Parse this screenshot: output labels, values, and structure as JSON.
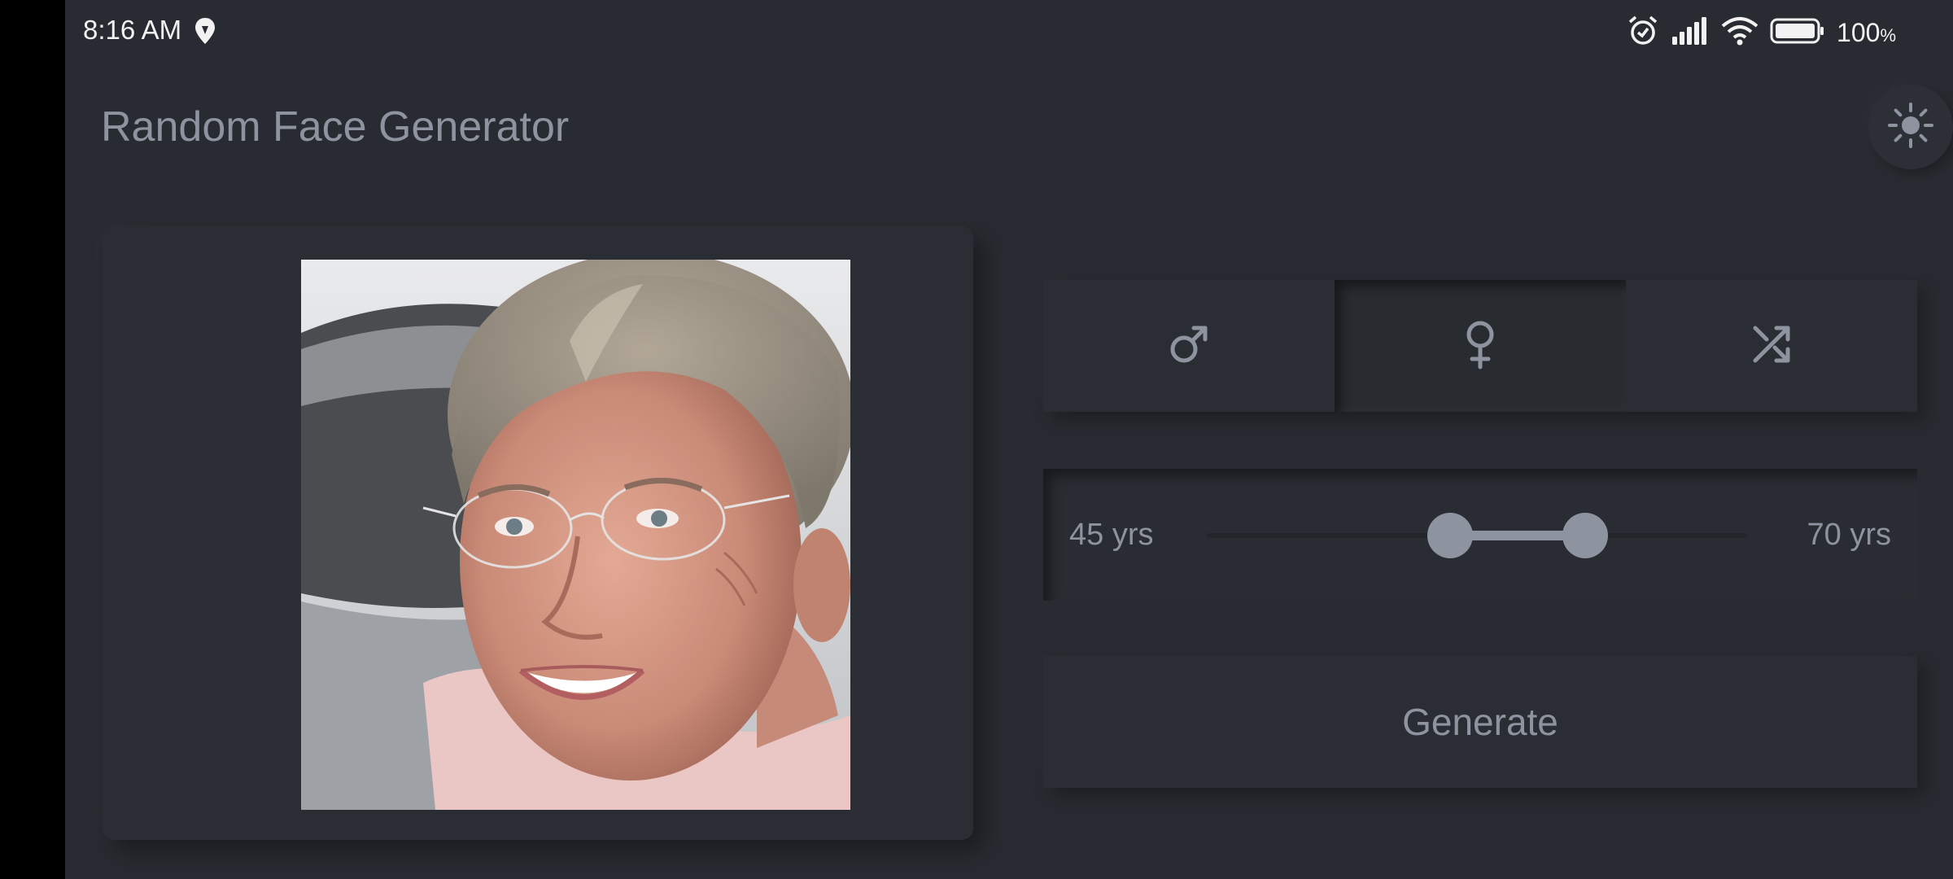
{
  "status_bar": {
    "time": "8:16 AM",
    "battery_percent": "100",
    "battery_unit": "%",
    "icons": [
      "location-icon",
      "alarm-icon",
      "signal-icon",
      "wifi-icon",
      "battery-icon"
    ]
  },
  "app_bar": {
    "title": "Random Face Generator",
    "theme_icon": "sun-icon"
  },
  "gender_selector": {
    "options": [
      {
        "icon": "male-icon",
        "selected": false
      },
      {
        "icon": "female-icon",
        "selected": true
      },
      {
        "icon": "shuffle-icon",
        "selected": false
      }
    ]
  },
  "age_range": {
    "min_label": "45 yrs",
    "max_label": "70 yrs",
    "low_fraction": 0.45,
    "high_fraction": 0.7
  },
  "generate": {
    "label": "Generate"
  },
  "colors": {
    "background": "#282b31",
    "accent": "#8d939f"
  }
}
